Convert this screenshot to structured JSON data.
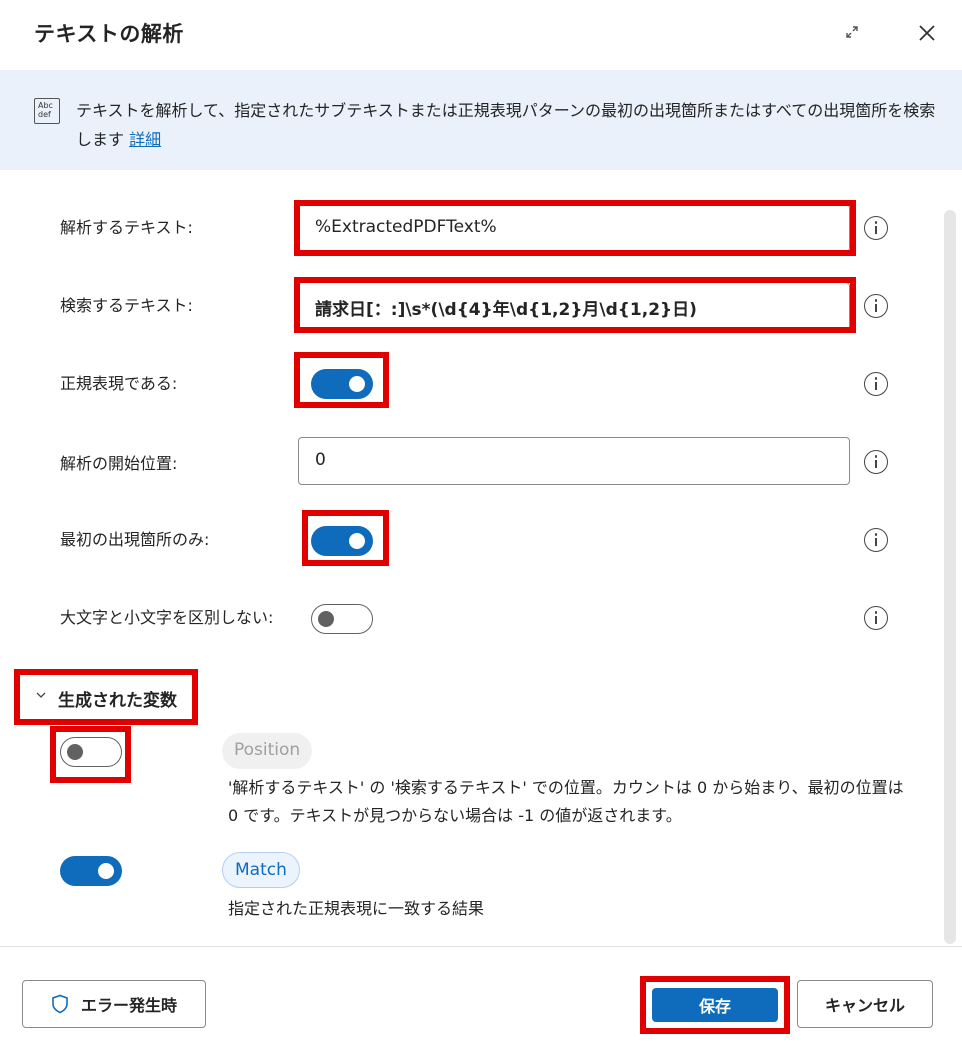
{
  "dialog": {
    "title": "テキストの解析"
  },
  "banner": {
    "icon": "text-abc-icon",
    "icon_text": "Abc def",
    "description": "テキストを解析して、指定されたサブテキストまたは正規表現パターンの最初の出現箇所またはすべての出現箇所を検索します",
    "link_label": "詳細"
  },
  "fields": {
    "text_to_parse": {
      "label": "解析するテキスト:",
      "value": "%ExtractedPDFText%"
    },
    "text_to_find": {
      "label": "検索するテキスト:",
      "value": "請求日[：:]\\s*(\\d{4}年\\d{1,2}月\\d{1,2}日)"
    },
    "is_regex": {
      "label": "正規表現である:",
      "on": true
    },
    "start_position": {
      "label": "解析の開始位置:",
      "value": "0"
    },
    "first_only": {
      "label": "最初の出現箇所のみ:",
      "on": true
    },
    "ignore_case": {
      "label": "大文字と小文字を区別しない:",
      "on": false
    }
  },
  "variables": {
    "section_label": "生成された変数",
    "items": [
      {
        "name": "Position",
        "enabled": false,
        "description": "'解析するテキスト' の '検索するテキスト' での位置。カウントは 0 から始まり、最初の位置は 0 です。テキストが見つからない場合は -1 の値が返されます。"
      },
      {
        "name": "Match",
        "enabled": true,
        "description": "指定された正規表現に一致する結果"
      }
    ]
  },
  "footer": {
    "error_button": "エラー発生時",
    "save_button": "保存",
    "cancel_button": "キャンセル"
  },
  "colors": {
    "accent": "#0f6cbd",
    "highlight": "#e00000",
    "banner_bg": "#eaf1fb"
  }
}
